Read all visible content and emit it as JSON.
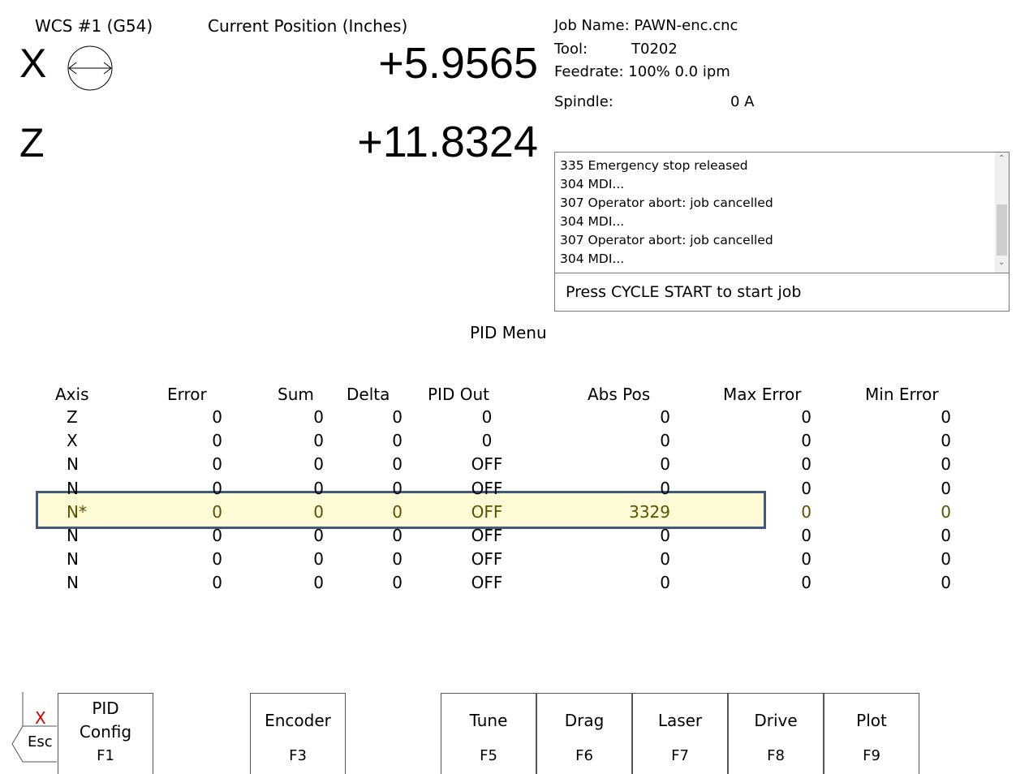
{
  "header": {
    "wcs_label": "WCS #1 (G54)",
    "position_title": "Current Position (Inches)"
  },
  "axes": [
    {
      "letter": "X",
      "value": "+5.9565",
      "icon": "diameter-mode-icon"
    },
    {
      "letter": "Z",
      "value": "+11.8324"
    }
  ],
  "job_info": {
    "job_name": "Job Name: PAWN-enc.cnc",
    "tool_label": "Tool:",
    "tool_value": "T0202",
    "feedrate": "Feedrate: 100%  0.0 ipm",
    "spindle_label": "Spindle:",
    "spindle_value": "0  A"
  },
  "message_log": [
    "335 Emergency stop released",
    "304 MDI...",
    "307 Operator abort:  job cancelled",
    "304 MDI...",
    "307 Operator abort:  job cancelled",
    "304 MDI..."
  ],
  "status_prompt": "Press CYCLE START to start job",
  "menu_title": "PID Menu",
  "table": {
    "headers": [
      "Axis",
      "Error",
      "Sum",
      "Delta",
      "PID Out",
      "Abs Pos",
      "Max Error",
      "Min Error"
    ],
    "rows": [
      [
        "Z",
        "0",
        "0",
        "0",
        "0",
        "0",
        "0",
        "0"
      ],
      [
        "X",
        "0",
        "0",
        "0",
        "0",
        "0",
        "0",
        "0"
      ],
      [
        "N",
        "0",
        "0",
        "0",
        "OFF",
        "0",
        "0",
        "0"
      ],
      [
        "N",
        "0",
        "0",
        "0",
        "OFF",
        "0",
        "0",
        "0"
      ],
      [
        "N*",
        "0",
        "0",
        "0",
        "OFF",
        "3329",
        "0",
        "0"
      ],
      [
        "N",
        "0",
        "0",
        "0",
        "OFF",
        "0",
        "0",
        "0"
      ],
      [
        "N",
        "0",
        "0",
        "0",
        "OFF",
        "0",
        "0",
        "0"
      ],
      [
        "N",
        "0",
        "0",
        "0",
        "OFF",
        "0",
        "0",
        "0"
      ]
    ],
    "highlight_row_index": 4
  },
  "function_keys": {
    "esc": {
      "x_label": "X",
      "label": "Esc"
    },
    "keys": [
      {
        "name": "fkey-pid-config",
        "line1": "PID",
        "line2": "Config",
        "fn": "F1"
      },
      {
        "name": "fkey-encoder",
        "line1": "Encoder",
        "line2": "",
        "fn": "F3"
      },
      {
        "name": "fkey-tune",
        "line1": "Tune",
        "line2": "",
        "fn": "F5"
      },
      {
        "name": "fkey-drag",
        "line1": "Drag",
        "line2": "",
        "fn": "F6"
      },
      {
        "name": "fkey-laser",
        "line1": "Laser",
        "line2": "",
        "fn": "F7"
      },
      {
        "name": "fkey-drive",
        "line1": "Drive",
        "line2": "",
        "fn": "F8"
      },
      {
        "name": "fkey-plot",
        "line1": "Plot",
        "line2": "",
        "fn": "F9"
      }
    ]
  },
  "colors": {
    "highlight_bg": "#fdfbd6",
    "highlight_border": "#41597a",
    "esc_x": "#d00000"
  }
}
